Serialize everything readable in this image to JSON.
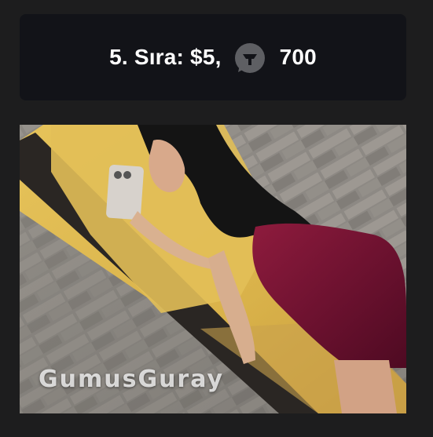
{
  "card": {
    "rank_label": "5. Sıra: $5,",
    "amount": "700",
    "icon": "gift-chat-bubble-icon"
  },
  "photo": {
    "watermark": "GumusGuray"
  }
}
